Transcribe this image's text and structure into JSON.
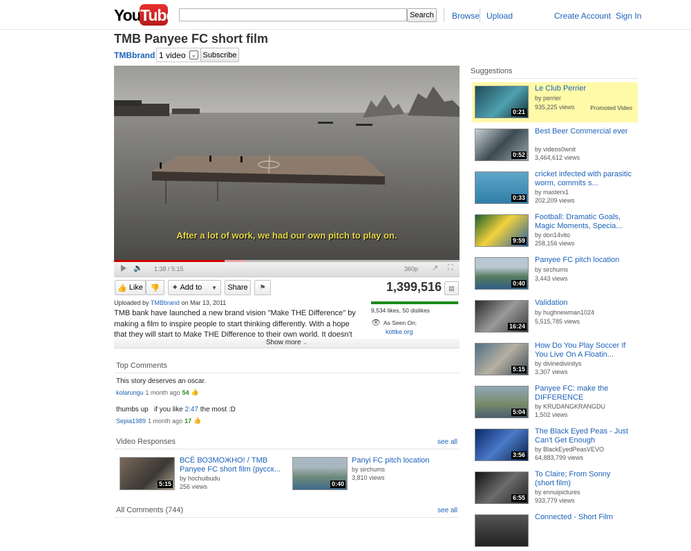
{
  "header": {
    "logo_you": "You",
    "logo_tube": "Tube",
    "search_placeholder": "",
    "search_label": "Search",
    "browse": "Browse",
    "upload": "Upload",
    "create_account": "Create Account",
    "sign_in": "Sign In"
  },
  "video": {
    "title": "TMB Panyee FC short film",
    "channel": "TMBbrand",
    "video_count": "1 video",
    "subscribe": "Subscribe",
    "subtitle": "After a lot of work, we had our own pitch to play on.",
    "time": "1:38 / 5:15",
    "quality": "360p",
    "progress_played": 0.32,
    "progress_buffered": 0.38,
    "like": "Like",
    "add_to": "Add to",
    "share": "Share",
    "views": "1,399,516",
    "uploaded_prefix": "Uploaded by",
    "uploaded_by": "TMBbrand",
    "uploaded_date": "on Mar 13, 2011",
    "description": "TMB bank have launched a new brand vision \"Make THE Difference\" by making a film to inspire people to start thinking differently. With a hope that they will start to Make THE Difference to their own world. It doesn't have to be",
    "show_more": "Show more",
    "likes_text": "9,534 likes, 50 dislikes",
    "like_ratio": 0.995,
    "as_seen_on": "As Seen On:",
    "as_seen_link": "kottke.org"
  },
  "top_comments": {
    "heading": "Top Comments",
    "items": [
      {
        "text": "This  story deserves an oscar.",
        "user": "kolarungu",
        "age": "1 month ago",
        "score": "54"
      },
      {
        "text_before": "thumbs up   if you like ",
        "time_link": "2:47",
        "text_after": " the most :D",
        "user": "Sepia1989",
        "age": "1 month ago",
        "score": "17"
      }
    ]
  },
  "video_responses": {
    "heading": "Video Responses",
    "see_all": "see all",
    "items": [
      {
        "title": "ВСЁ ВОЗМОЖНО! / TMB Panyee FC short film (русск...",
        "by": "by hochuibudu",
        "views": "256 views",
        "duration": "5:15"
      },
      {
        "title": "Panyi FC pitch location",
        "by": "by sirchums",
        "views": "3,810 views",
        "duration": "0:40"
      }
    ]
  },
  "all_comments": {
    "heading": "All Comments (744)",
    "see_all": "see all"
  },
  "suggestions": {
    "heading": "Suggestions",
    "promoted_label": "Promoted Video",
    "items": [
      {
        "title": "Le Club Perrier",
        "by": "by perrier",
        "views": "935,225 views",
        "duration": "0:21",
        "promoted": true
      },
      {
        "title": "Best Beer Commercial ever",
        "by": "by videos0wnit",
        "views": "3,464,612 views",
        "duration": "0:52"
      },
      {
        "title": "cricket infected with parasitic worm, commits s...",
        "by": "by masterx1",
        "views": "202,209 views",
        "duration": "0:33"
      },
      {
        "title": "Football: Dramatic Goals, Magic Moments, Specia...",
        "by": "by don14vito",
        "views": "258,156 views",
        "duration": "9:59"
      },
      {
        "title": "Panyee FC pitch location",
        "by": "by sirchums",
        "views": "3,443 views",
        "duration": "0:40"
      },
      {
        "title": "Validation",
        "by": "by hughnewman1024",
        "views": "5,515,785 views",
        "duration": "16:24"
      },
      {
        "title": "How Do You Play Soccer If You Live On A Floatin...",
        "by": "by divinedivinitys",
        "views": "3,307 views",
        "duration": "5:15"
      },
      {
        "title": "Panyee FC: make the DIFFERENCE",
        "by": "by KRUDANGKRANGDU",
        "views": "1,502 views",
        "duration": "5:04"
      },
      {
        "title": "The Black Eyed Peas - Just Can't Get Enough",
        "by": "by BlackEyedPeasVEVO",
        "views": "64,883,799 views",
        "duration": "3:56"
      },
      {
        "title": "To Claire; From Sonny (short film)",
        "by": "by ennuipictures",
        "views": "933,779 views",
        "duration": "6:55"
      },
      {
        "title": "Connected - Short Film",
        "by": "",
        "views": "",
        "duration": ""
      }
    ]
  }
}
